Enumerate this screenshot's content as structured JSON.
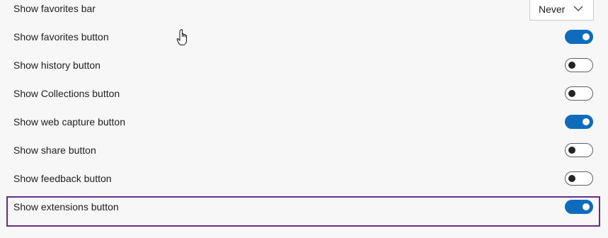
{
  "favorites_bar": {
    "label": "Show favorites bar",
    "dropdown_value": "Never"
  },
  "toggles": [
    {
      "label": "Show favorites button",
      "state": "on"
    },
    {
      "label": "Show history button",
      "state": "off"
    },
    {
      "label": "Show Collections button",
      "state": "off"
    },
    {
      "label": "Show web capture button",
      "state": "on"
    },
    {
      "label": "Show share button",
      "state": "off"
    },
    {
      "label": "Show feedback button",
      "state": "off"
    },
    {
      "label": "Show extensions button",
      "state": "on"
    }
  ],
  "colors": {
    "toggle_on": "#0f6cbd",
    "highlight_border": "#6b2c86",
    "background": "#f7f7f7"
  },
  "icons": {
    "dropdown": "chevron-down-icon",
    "pointer": "hand-cursor-icon"
  }
}
